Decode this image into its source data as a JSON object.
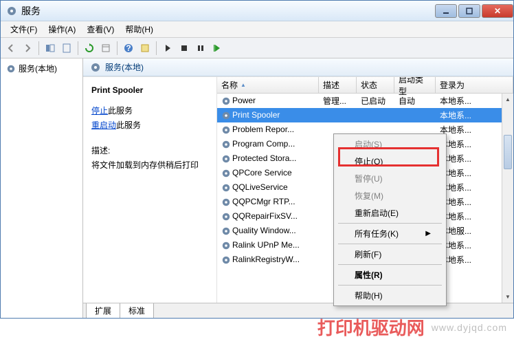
{
  "window": {
    "title": "服务"
  },
  "menu": {
    "file": "文件(F)",
    "action": "操作(A)",
    "view": "查看(V)",
    "help": "帮助(H)"
  },
  "tree": {
    "root": "服务(本地)"
  },
  "panel_title": "服务(本地)",
  "detail": {
    "name": "Print Spooler",
    "stop_link": "停止",
    "stop_suffix": "此服务",
    "restart_link": "重启动",
    "restart_suffix": "此服务",
    "desc_label": "描述:",
    "desc_text": "将文件加载到内存供稍后打印"
  },
  "columns": {
    "name": "名称",
    "desc": "描述",
    "status": "状态",
    "type": "启动类型",
    "login": "登录为"
  },
  "services": [
    {
      "name": "Power",
      "desc": "管理...",
      "status": "已启动",
      "type": "自动",
      "login": "本地系..."
    },
    {
      "name": "Print Spooler",
      "desc": "",
      "status": "",
      "type": "",
      "login": "本地系...",
      "selected": true
    },
    {
      "name": "Problem Repor...",
      "desc": "",
      "status": "",
      "type": "",
      "login": "本地系..."
    },
    {
      "name": "Program Comp...",
      "desc": "",
      "status": "",
      "type": "",
      "login": "本地系..."
    },
    {
      "name": "Protected Stora...",
      "desc": "",
      "status": "",
      "type": "",
      "login": "本地系..."
    },
    {
      "name": "QPCore Service",
      "desc": "",
      "status": "",
      "type": "",
      "login": "本地系..."
    },
    {
      "name": "QQLiveService",
      "desc": "",
      "status": "",
      "type": "",
      "login": "本地系..."
    },
    {
      "name": "QQPCMgr RTP...",
      "desc": "",
      "status": "",
      "type": "",
      "login": "本地系..."
    },
    {
      "name": "QQRepairFixSV...",
      "desc": "",
      "status": "",
      "type": "",
      "login": "本地系..."
    },
    {
      "name": "Quality Window...",
      "desc": "",
      "status": "",
      "type": "",
      "login": "本地服..."
    },
    {
      "name": "Ralink UPnP Me...",
      "desc": "",
      "status": "",
      "type": "",
      "login": "本地系..."
    },
    {
      "name": "RalinkRegistryW...",
      "desc": "",
      "status": "",
      "type": "",
      "login": "本地系..."
    }
  ],
  "context": {
    "start": "启动(S)",
    "stop": "停止(O)",
    "pause": "暂停(U)",
    "resume": "恢复(M)",
    "restart": "重新启动(E)",
    "all_tasks": "所有任务(K)",
    "refresh": "刷新(F)",
    "properties": "属性(R)",
    "help": "帮助(H)"
  },
  "tabs": {
    "extended": "扩展",
    "standard": "标准"
  },
  "watermark": {
    "cn": "打印机驱动网",
    "en": "www.dyjqd.com"
  }
}
